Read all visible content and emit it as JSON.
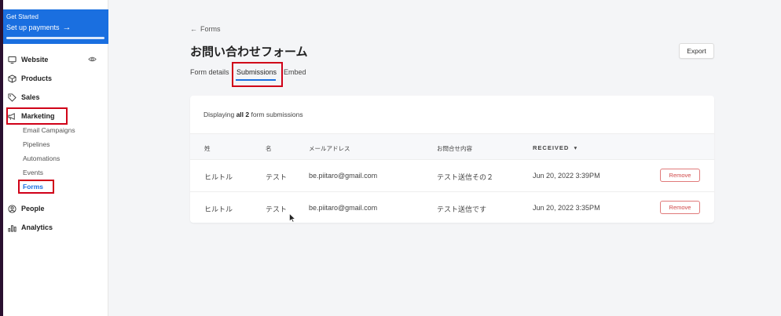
{
  "sidebar": {
    "banner": {
      "eyebrow": "Get Started",
      "title": "Set up payments",
      "progress": 1.0
    },
    "items": [
      {
        "label": "Website",
        "icon": "monitor-icon"
      },
      {
        "label": "Products",
        "icon": "box-icon"
      },
      {
        "label": "Sales",
        "icon": "tag-icon"
      },
      {
        "label": "Marketing",
        "icon": "megaphone-icon"
      },
      {
        "label": "People",
        "icon": "user-circle-icon"
      },
      {
        "label": "Analytics",
        "icon": "bar-chart-icon"
      }
    ],
    "marketing_sub": [
      "Email Campaigns",
      "Pipelines",
      "Automations",
      "Events",
      "Forms"
    ]
  },
  "main": {
    "back_label": "Forms",
    "title": "お問い合わせフォーム",
    "export_label": "Export",
    "tabs": [
      "Form details",
      "Submissions",
      "Embed"
    ],
    "active_tab": "Submissions",
    "summary_prefix": "Displaying ",
    "summary_bold": "all 2",
    "summary_suffix": " form submissions",
    "columns": [
      "姓",
      "名",
      "メールアドレス",
      "お問合せ内容",
      "RECEIVED"
    ],
    "rows": [
      {
        "last": "ヒルトル",
        "first": "テスト",
        "email": "be.piitaro@gmail.com",
        "content": "テスト送信その２",
        "received": "Jun 20, 2022 3:39PM",
        "action": "Remove"
      },
      {
        "last": "ヒルトル",
        "first": "テスト",
        "email": "be.piitaro@gmail.com",
        "content": "テスト送信です",
        "received": "Jun 20, 2022 3:35PM",
        "action": "Remove"
      }
    ]
  },
  "colors": {
    "accent": "#1a6fe0",
    "highlight": "#d00018",
    "danger": "#d04848"
  }
}
